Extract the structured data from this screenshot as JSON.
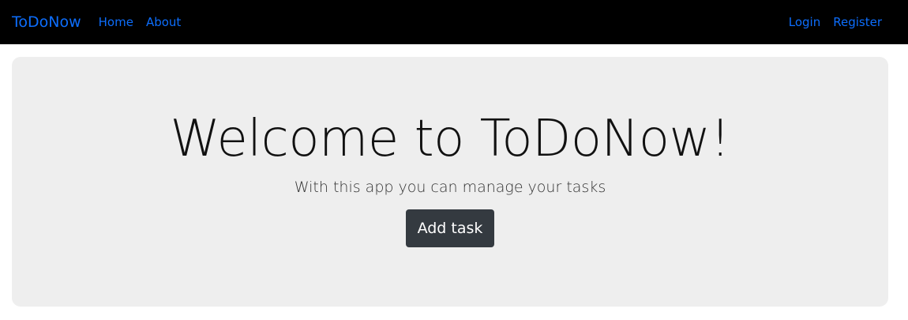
{
  "navbar": {
    "brand": "ToDoNow",
    "left_links": [
      "Home",
      "About"
    ],
    "right_links": [
      "Login",
      "Register"
    ],
    "background": "#000000",
    "link_color": "#0d6efd"
  },
  "hero": {
    "title": "Welcome to ToDoNow!",
    "lead": "With this app you can manage your tasks",
    "button_label": "Add task",
    "background": "#eeeeee",
    "button_color": "#343a40"
  }
}
